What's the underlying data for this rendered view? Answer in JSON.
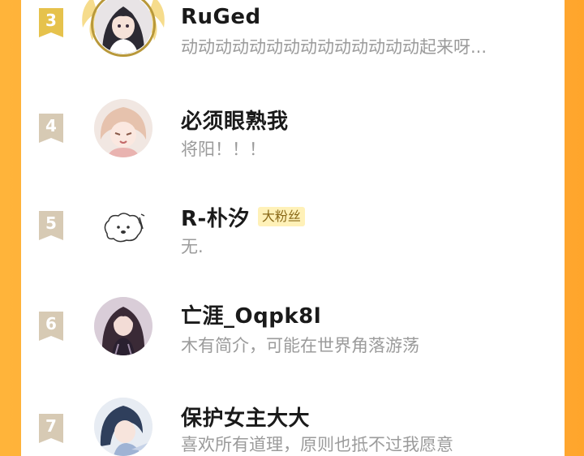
{
  "colors": {
    "background_gradient_start": "#ffb43a",
    "background_gradient_end": "#ffa52c",
    "rank_badge": "#d7cab4",
    "rank_badge_top3": "#e6c24c",
    "fan_badge_bg": "#fff1b8",
    "fan_badge_text": "#8a6a18",
    "name_text": "#1a1a1a",
    "desc_text": "#9b9b9b"
  },
  "ranking": [
    {
      "rank": "3",
      "name": "RuGed",
      "badge": "",
      "description": "动动动动动动动动动动动动动动起来呀...",
      "avatar_icon": "anime-girl-avatar-icon",
      "top_rank": true
    },
    {
      "rank": "4",
      "name": "必须眼熟我",
      "badge": "",
      "description": "将阳！！！",
      "avatar_icon": "anime-boy-avatar-icon",
      "top_rank": false
    },
    {
      "rank": "5",
      "name": "R-朴汐",
      "badge": "大粉丝",
      "description": "无.",
      "avatar_icon": "doodle-dog-avatar-icon",
      "top_rank": false
    },
    {
      "rank": "6",
      "name": "亡涯_Oqpk8l",
      "badge": "",
      "description": "木有简介，可能在世界角落游荡",
      "avatar_icon": "anime-woman-avatar-icon",
      "top_rank": false
    },
    {
      "rank": "7",
      "name": "保护女主大大",
      "badge": "",
      "description": "喜欢所有道理，原则也抵不过我愿意",
      "avatar_icon": "anime-character-avatar-icon",
      "top_rank": false
    }
  ]
}
